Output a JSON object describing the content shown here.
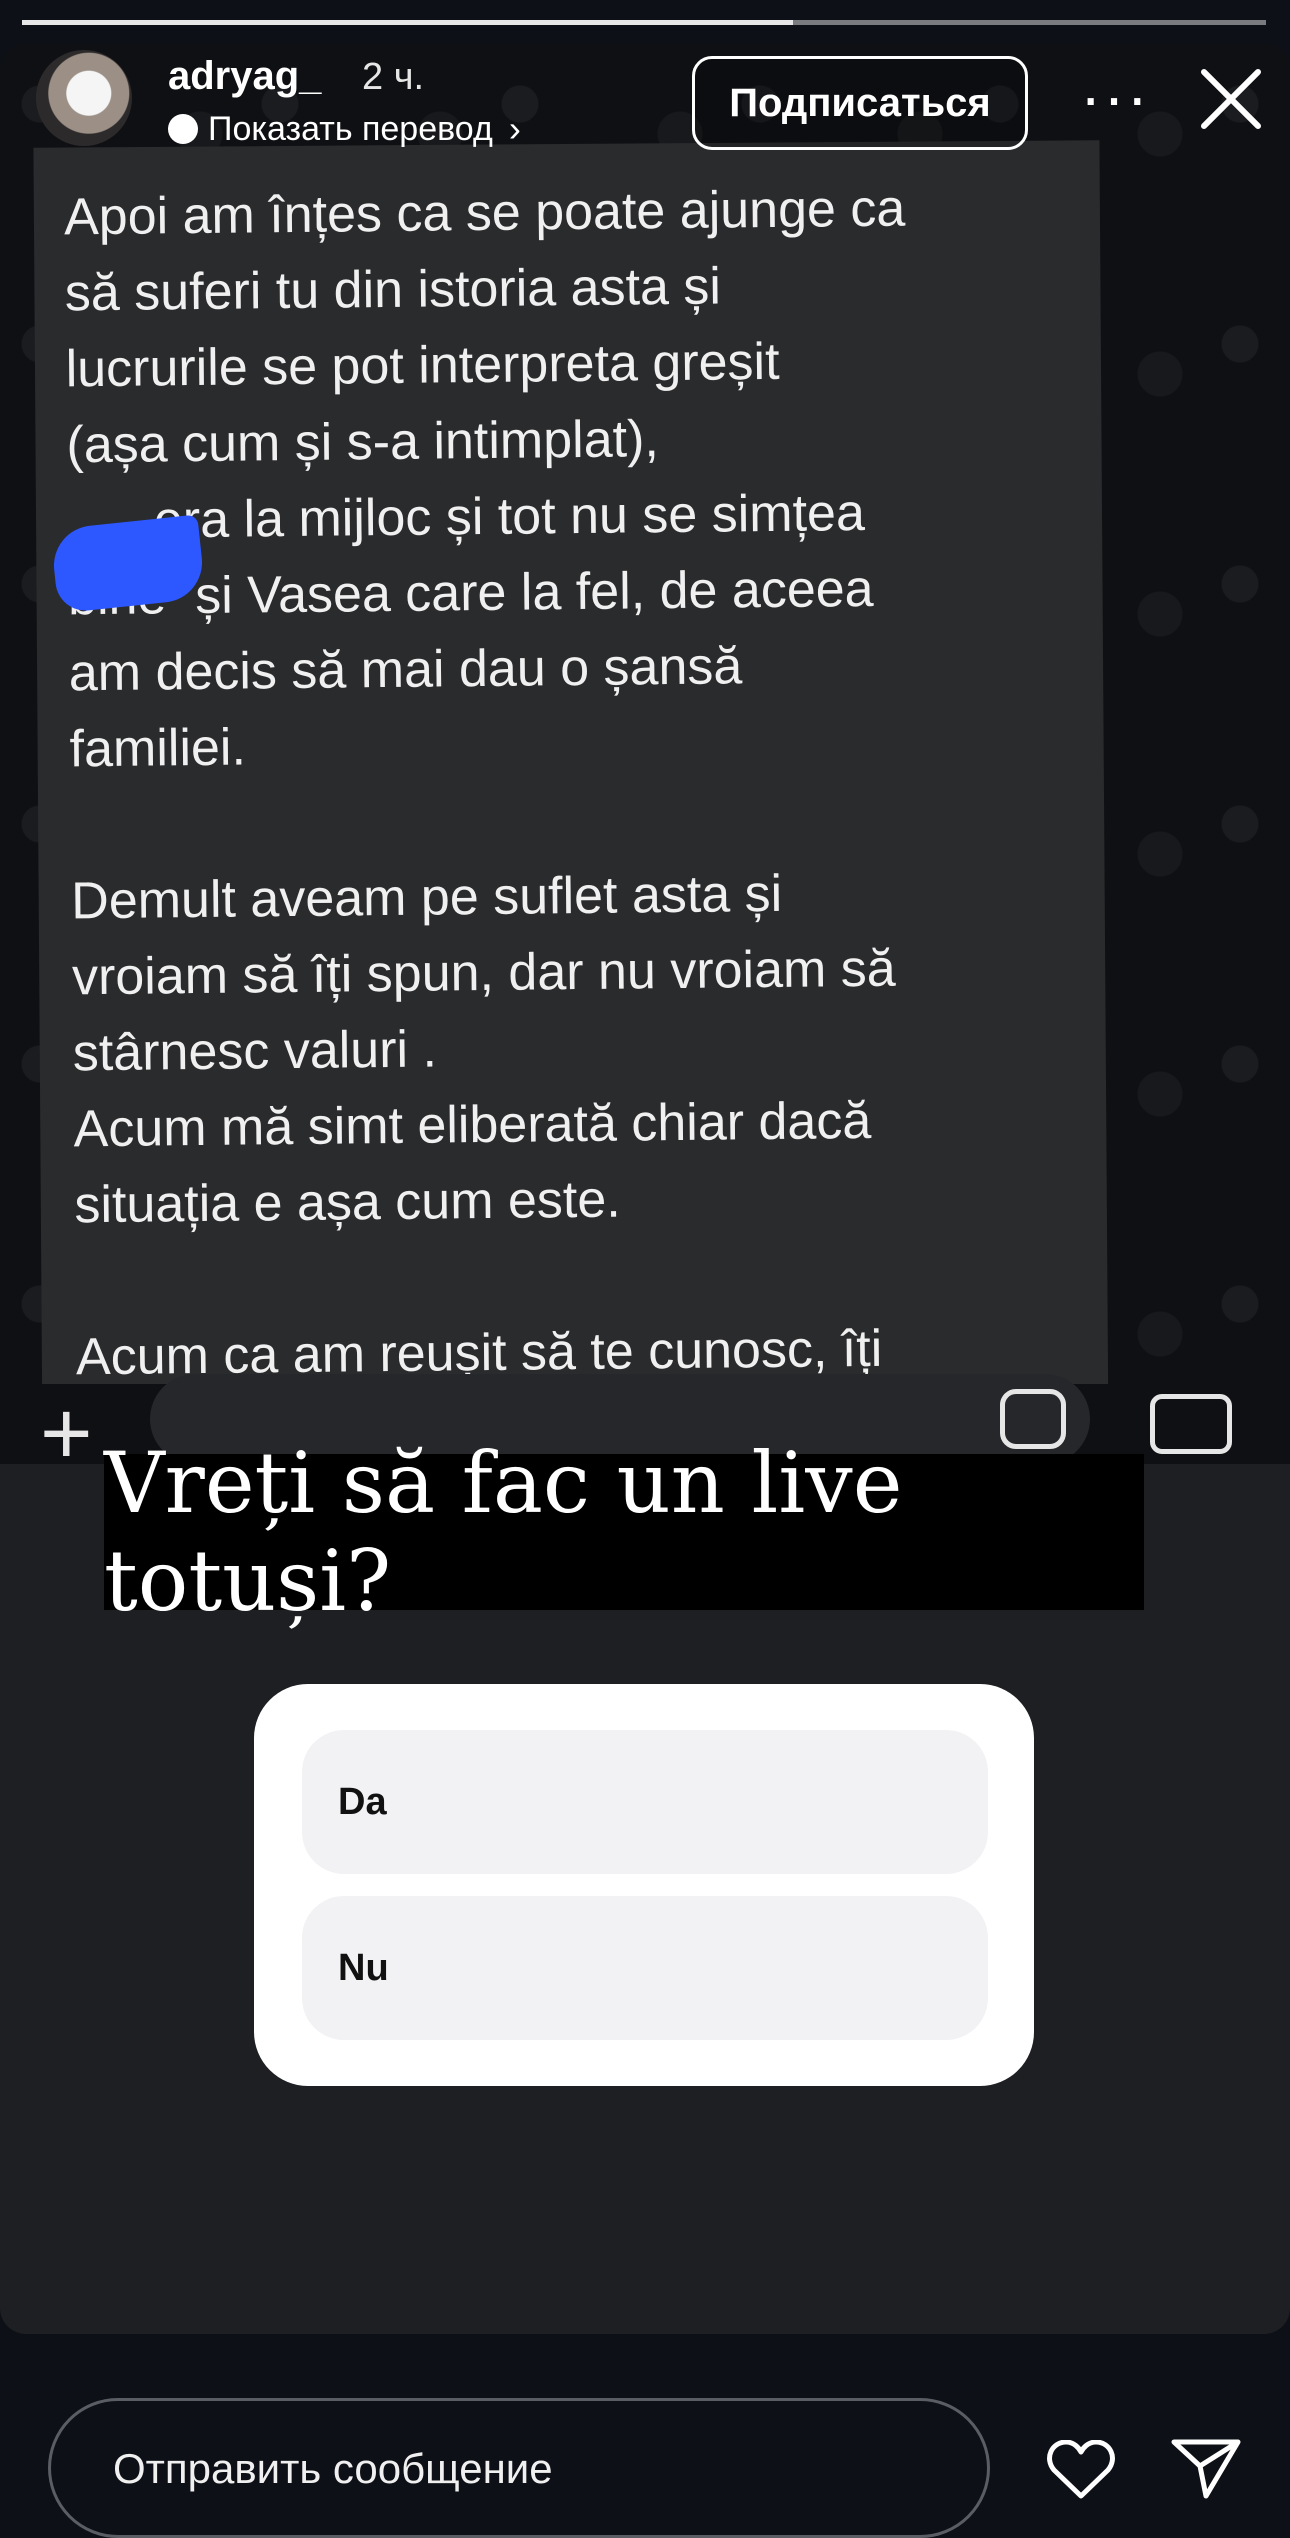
{
  "header": {
    "username": "adryag_",
    "time": "2 ч.",
    "translate": "Показать перевод",
    "follow": "Подписаться",
    "more": "···",
    "progress_completed_fraction": 0.62
  },
  "chat_message": {
    "text": "Apoi am înțes ca se poate ajunge ca\nsă suferi tu din istoria asta și\nlucrurile se pot interpreta greșit\n(așa cum și s-a intimplat),\n      era la mijloc și tot nu se simțea\nbine  și Vasea care la fel, de aceea\nam decis să mai dau o șansă\nfamiliei.\n\nDemult aveam pe suflet asta și\nvroiam să îți spun, dar nu vroiam să\nstârnesc valuri .\nAcum mă simt eliberată chiar dacă\nsituația e așa cum este.\n\nAcum ca am reușit să te cunosc, îți"
  },
  "question": {
    "text": "Vreți să fac un live totuși?"
  },
  "poll": {
    "options": [
      "Da",
      "Nu"
    ]
  },
  "reply": {
    "placeholder": "Отправить сообщение"
  },
  "colors": {
    "background": "#0d1016",
    "story": "#1d1f22",
    "bubble": "#2a2b2d",
    "scribble": "#2d58ff"
  }
}
